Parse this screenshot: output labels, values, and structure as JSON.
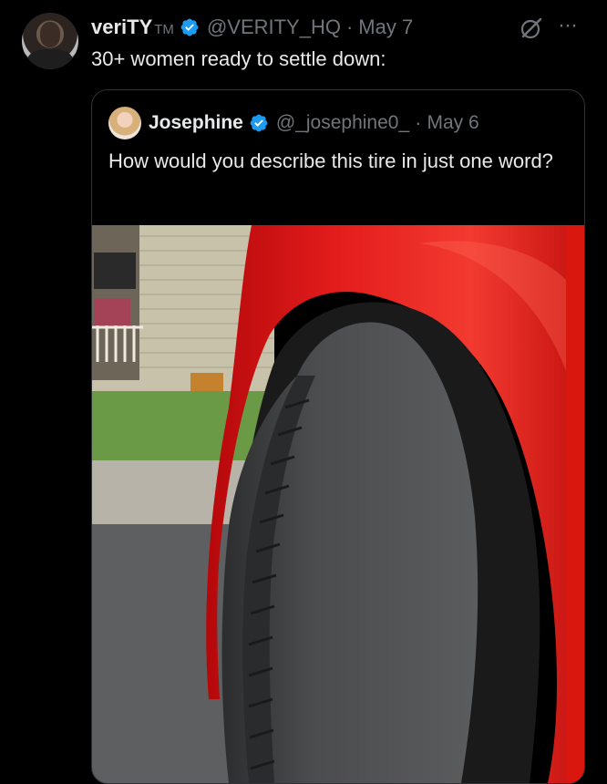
{
  "tweet": {
    "author_name": "veriTY",
    "author_suffix": "TM",
    "handle": "@VERITY_HQ",
    "separator": "·",
    "date": "May 7",
    "text": "30+ women ready to settle down:",
    "verified_color": "#1d9bf0"
  },
  "quoted_tweet": {
    "author_name": "Josephine",
    "handle": "@_josephine0_",
    "separator": "·",
    "date": "May 6",
    "text": "How would you describe this tire in just one word?"
  },
  "icons": {
    "verified": "verified-badge-icon",
    "grok": "grok-icon",
    "more": "more-options-icon"
  },
  "more_label": "···"
}
